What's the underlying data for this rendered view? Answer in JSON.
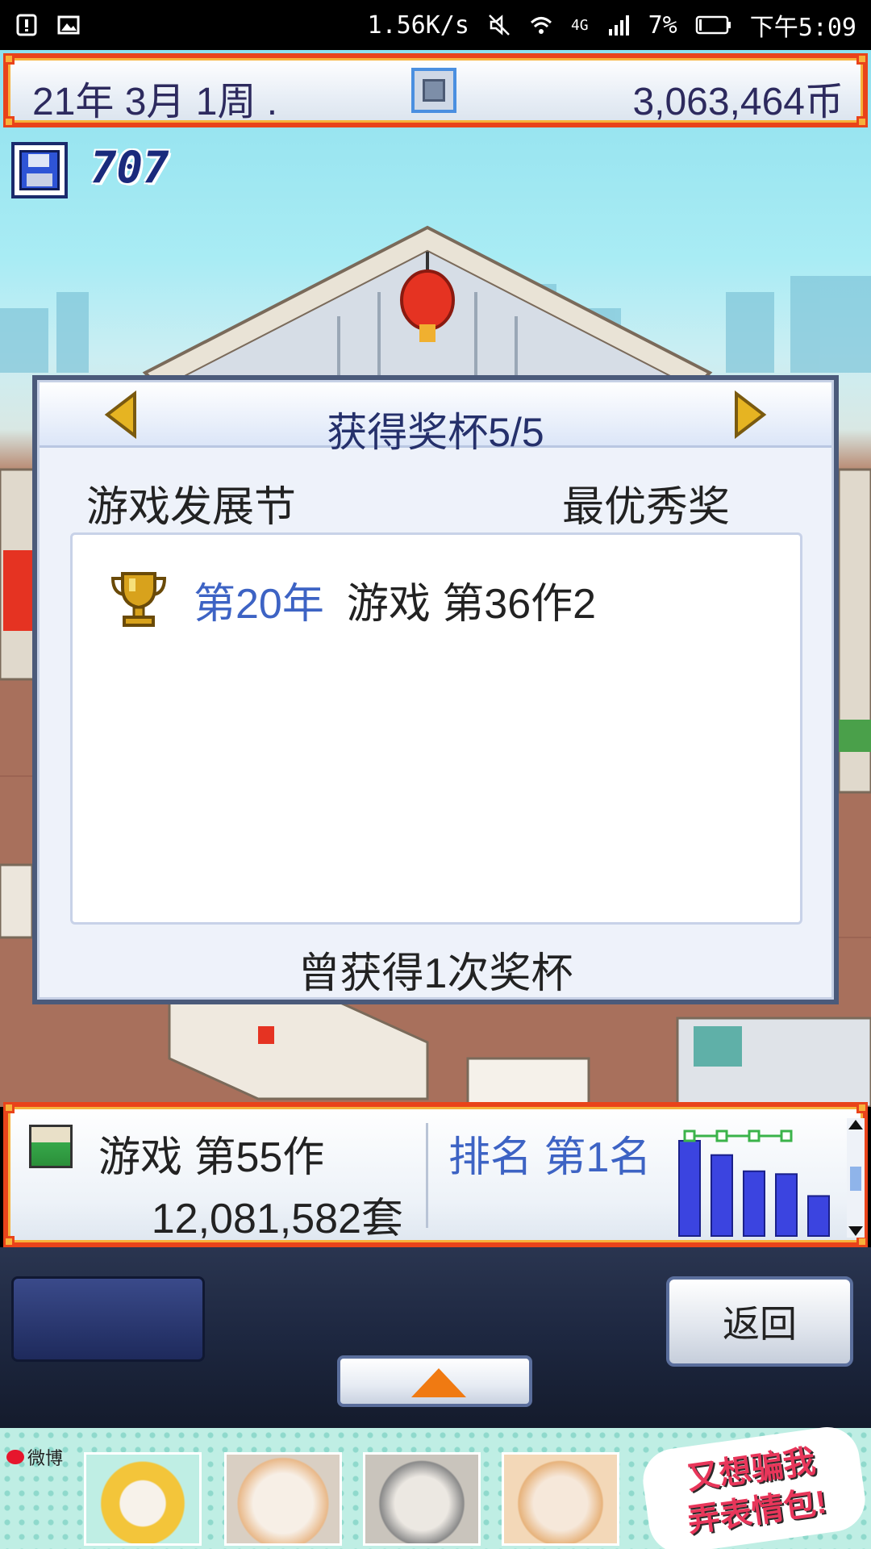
{
  "status_bar": {
    "network_speed": "1.56K/s",
    "network_type": "4G",
    "battery": "7%",
    "time": "下午5:09",
    "icons": [
      "alert-icon",
      "image-icon",
      "mute-icon",
      "wifi-icon",
      "signal-icon",
      "battery-icon"
    ]
  },
  "top_bar": {
    "date": "21年 3月 1周 .",
    "money": "3,063,464币"
  },
  "save": {
    "count": "707"
  },
  "dialog": {
    "title": "获得奖杯5/5",
    "festival": "游戏发展节",
    "award_name": "最优秀奖",
    "awards": [
      {
        "year": "第20年",
        "game": "游戏 第36作2"
      }
    ],
    "footer": "曾获得1次奖杯"
  },
  "info_bar": {
    "game_title": "游戏 第55作",
    "sales": "12,081,582套",
    "rank": "排名 第1名",
    "rank_chart": {
      "bars": [
        1.0,
        0.85,
        0.68,
        0.65,
        0.42
      ],
      "line_markers": 4,
      "bar_color": "#3b44e0"
    }
  },
  "menu": {
    "back_label": "返回"
  },
  "ad": {
    "brand": "微博",
    "slogan_line1": "又想骗我",
    "slogan_line2": "弄表情包!"
  },
  "colors": {
    "frame": "#e9431a",
    "frame_inner": "#f7b13b",
    "title_text": "#25306b",
    "accent_blue": "#3d63c4"
  }
}
